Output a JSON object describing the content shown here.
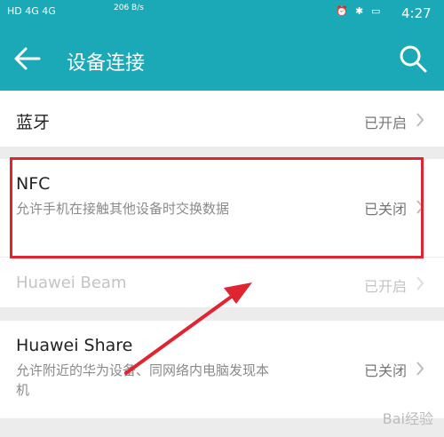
{
  "status": {
    "left": "HD 4G 4G",
    "speed": "206 B/s",
    "time": "4:27"
  },
  "header": {
    "title": "设备连接"
  },
  "rows": [
    {
      "title": "蓝牙",
      "desc": "",
      "value": "已开启"
    },
    {
      "title": "NFC",
      "desc": "允许手机在接触其他设备时交换数据",
      "value": "已关闭"
    },
    {
      "title": "Huawei Beam",
      "desc": "",
      "value": "已开启"
    },
    {
      "title": "Huawei Share",
      "desc": "允许附近的华为设备、同网络内电脑发现本机",
      "value": "已关闭"
    }
  ],
  "watermark": "Bai经验",
  "colors": {
    "accent": "#1ba9b8",
    "highlight": "#e02431"
  }
}
